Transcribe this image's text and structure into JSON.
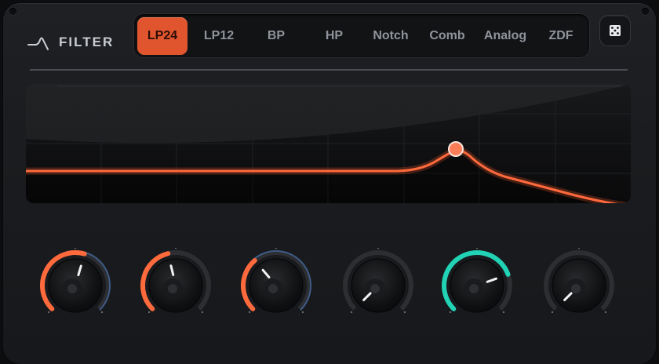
{
  "header": {
    "title": "FILTER",
    "icon": "filter-curve-icon"
  },
  "filter_types": [
    {
      "label": "LP24",
      "active": true
    },
    {
      "label": "LP12",
      "active": false
    },
    {
      "label": "BP",
      "active": false
    },
    {
      "label": "HP",
      "active": false
    },
    {
      "label": "Notch",
      "active": false
    },
    {
      "label": "Comb",
      "active": false
    },
    {
      "label": "Analog",
      "active": false
    },
    {
      "label": "ZDF",
      "active": false
    }
  ],
  "randomize": {
    "icon": "dice-icon"
  },
  "response": {
    "cutoff_position": 0.71,
    "peak_position_label": "resonance-node"
  },
  "knobs": [
    {
      "value": 0.56,
      "accent": "#ff6a3d",
      "mod": "#3f5b86"
    },
    {
      "value": 0.45,
      "accent": "#ff6a3d",
      "mod": null
    },
    {
      "value": 0.35,
      "accent": "#ff6a3d",
      "mod": "#3f5b86"
    },
    {
      "value": 0.0,
      "accent": "#ff6a3d",
      "mod": null
    },
    {
      "value": 0.76,
      "accent": "#21d3b4",
      "mod": null
    },
    {
      "value": 0.0,
      "accent": "#21d3b4",
      "mod": null
    }
  ],
  "colors": {
    "accent": "#e0552e",
    "curve": "#ff6a3d",
    "teal": "#21d3b4"
  }
}
